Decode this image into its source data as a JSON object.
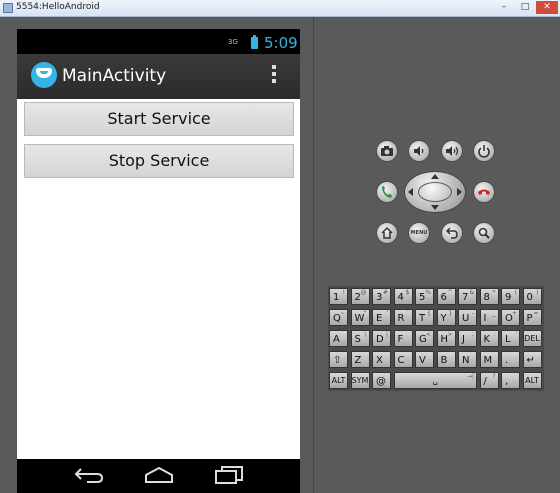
{
  "window": {
    "title": "5554:HelloAndroid",
    "min_glyph": "–",
    "max_glyph": "□",
    "close_glyph": "✕"
  },
  "status_bar": {
    "network": "3G",
    "time": "5:09"
  },
  "action_bar": {
    "title": "MainActivity"
  },
  "buttons": {
    "start": "Start Service",
    "stop": "Stop Service"
  },
  "colors": {
    "accent": "#33b5e5",
    "call_green": "#2e9a3c",
    "end_call_red": "#cc2b2b"
  },
  "hardware": {
    "icons": [
      "camera-icon",
      "volume-down-icon",
      "volume-up-icon",
      "power-icon",
      "call-icon",
      "end-call-icon",
      "home-icon",
      "back-icon",
      "search-icon"
    ],
    "menu_label": "MENU"
  },
  "keyboard": {
    "rows": [
      [
        [
          "1",
          "!"
        ],
        [
          "2",
          "@"
        ],
        [
          "3",
          "#"
        ],
        [
          "4",
          "$"
        ],
        [
          "5",
          "%"
        ],
        [
          "6",
          "^"
        ],
        [
          "7",
          "&"
        ],
        [
          "8",
          "*"
        ],
        [
          "9",
          "("
        ],
        [
          "0",
          ")"
        ]
      ],
      [
        [
          "Q",
          "~"
        ],
        [
          "W",
          "\""
        ],
        [
          "E",
          "'"
        ],
        [
          "R",
          "`"
        ],
        [
          "T",
          "{"
        ],
        [
          "Y",
          "}"
        ],
        [
          "U",
          "-"
        ],
        [
          "I",
          "_"
        ],
        [
          "O",
          "+"
        ],
        [
          "P",
          "="
        ]
      ],
      [
        [
          "A",
          ""
        ],
        [
          "S",
          "\\"
        ],
        [
          "D",
          "|"
        ],
        [
          "F",
          ""
        ],
        [
          "G",
          "<"
        ],
        [
          "H",
          ">"
        ],
        [
          "J",
          ";"
        ],
        [
          "K",
          ":"
        ],
        [
          "L",
          "'"
        ],
        [
          "DEL",
          ""
        ]
      ],
      [
        [
          "⇧",
          ""
        ],
        [
          "Z",
          ""
        ],
        [
          "X",
          ""
        ],
        [
          "C",
          ""
        ],
        [
          "V",
          ""
        ],
        [
          "B",
          ""
        ],
        [
          "N",
          ""
        ],
        [
          "M",
          ""
        ],
        [
          ".",
          ""
        ],
        [
          "↵",
          ""
        ]
      ],
      [
        [
          "ALT",
          ""
        ],
        [
          "SYM",
          ""
        ],
        [
          "@",
          ""
        ],
        [
          "␣",
          "→|"
        ],
        [
          "/",
          "?"
        ],
        [
          ",",
          ""
        ],
        [
          "ALT",
          ""
        ]
      ]
    ]
  }
}
